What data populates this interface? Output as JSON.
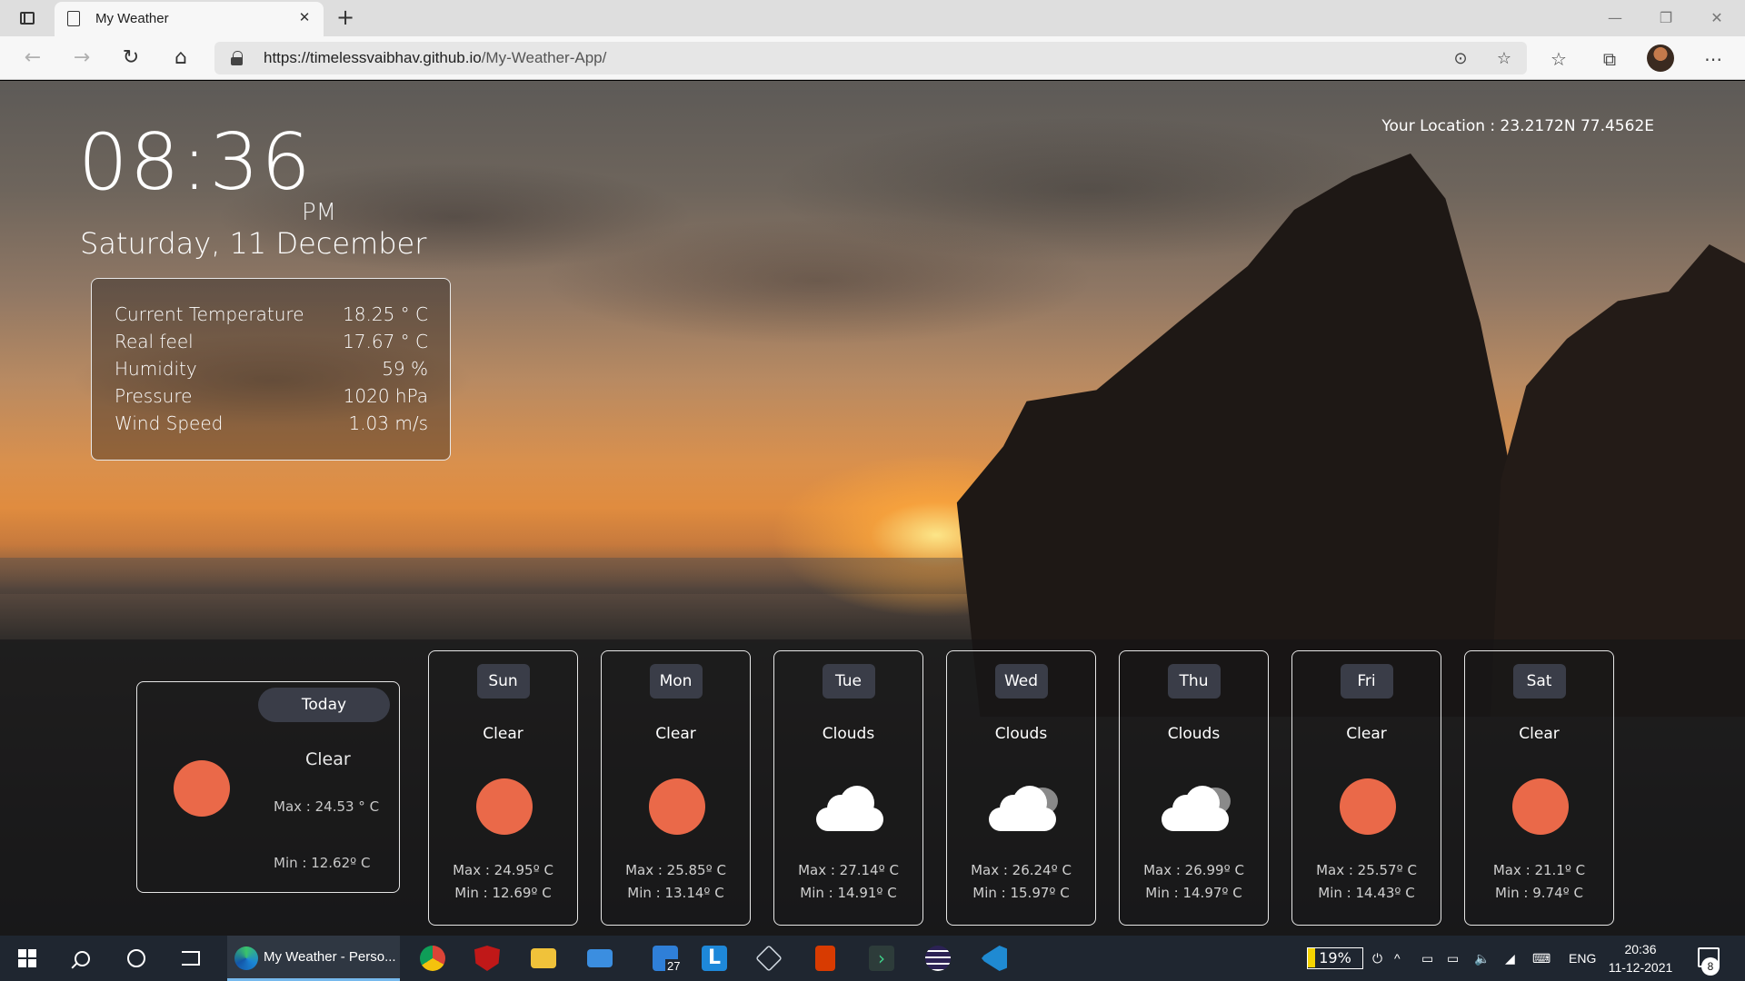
{
  "browser": {
    "tab_title": "My Weather",
    "tab_close_glyph": "✕",
    "new_tab_glyph": "+",
    "url_host": "https://timelessvaibhav.github.io",
    "url_path": "/My-Weather-App/",
    "icons": [
      "tab-actions-icon",
      "page-icon",
      "back-icon",
      "forward-icon",
      "refresh-icon",
      "home-icon",
      "lock-icon",
      "location-icon",
      "add-favorite-icon",
      "favorites-icon",
      "collections-icon",
      "profile-avatar",
      "more-icon",
      "minimize-icon",
      "restore-icon",
      "close-icon"
    ]
  },
  "weather": {
    "time": "08:36",
    "ampm": "PM",
    "date": "Saturday, 11 December",
    "location": "Your Location : 23.2172N 77.4562E",
    "details": [
      {
        "label": "Current Temperature",
        "value": "18.25 ° C"
      },
      {
        "label": "Real feel",
        "value": "17.67 ° C"
      },
      {
        "label": "Humidity",
        "value": "59 %"
      },
      {
        "label": "Pressure",
        "value": "1020 hPa"
      },
      {
        "label": "Wind Speed",
        "value": "1.03 m/s"
      }
    ],
    "today": {
      "day": "Today",
      "condition": "Clear",
      "icon": "sun-icon",
      "max": "Max : 24.53 ° C",
      "min": "Min : 12.62º C"
    },
    "forecast": [
      {
        "day": "Sun",
        "condition": "Clear",
        "icon": "sun-icon",
        "max": "Max : 24.95º C",
        "min": "Min : 12.69º C"
      },
      {
        "day": "Mon",
        "condition": "Clear",
        "icon": "sun-icon",
        "max": "Max : 25.85º C",
        "min": "Min : 13.14º C"
      },
      {
        "day": "Tue",
        "condition": "Clouds",
        "icon": "cloud-icon",
        "max": "Max : 27.14º C",
        "min": "Min : 14.91º C"
      },
      {
        "day": "Wed",
        "condition": "Clouds",
        "icon": "cloud-icon",
        "max": "Max : 26.24º C",
        "min": "Min : 15.97º C"
      },
      {
        "day": "Thu",
        "condition": "Clouds",
        "icon": "cloud-icon",
        "max": "Max : 26.99º C",
        "min": "Min : 14.97º C"
      },
      {
        "day": "Fri",
        "condition": "Clear",
        "icon": "sun-icon",
        "max": "Max : 25.57º C",
        "min": "Min : 14.43º C"
      },
      {
        "day": "Sat",
        "condition": "Clear",
        "icon": "sun-icon",
        "max": "Max : 21.1º C",
        "min": "Min : 9.74º C"
      }
    ],
    "colors": {
      "sun": "#ea6949",
      "pill": "#3a3d48"
    }
  },
  "taskbar": {
    "active_app_label": "My Weather - Perso...",
    "calendar_badge": "27",
    "battery": "19%",
    "language": "ENG",
    "time": "20:36",
    "date": "11-12-2021",
    "notification_count": "8",
    "icons": [
      "windows-start-icon",
      "search-icon",
      "cortana-icon",
      "task-view-icon",
      "edge-icon",
      "chrome-icon",
      "mcafee-icon",
      "file-explorer-icon",
      "mail-icon",
      "calendar-icon",
      "l-app-icon",
      "package-icon",
      "office-icon",
      "arrow-app-icon",
      "eclipse-icon",
      "vscode-icon"
    ]
  }
}
